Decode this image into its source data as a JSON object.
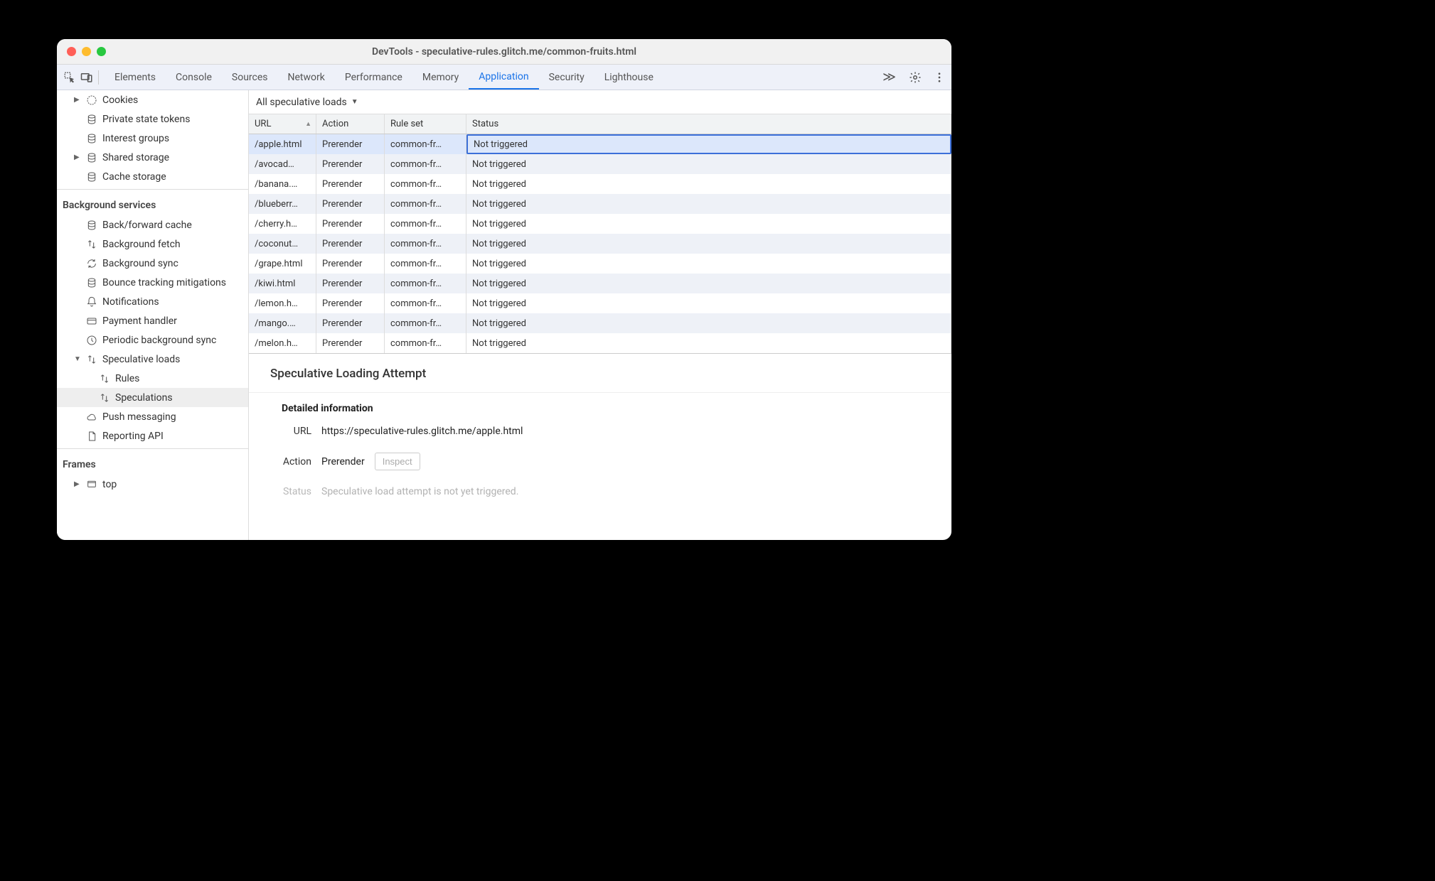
{
  "window": {
    "title": "DevTools - speculative-rules.glitch.me/common-fruits.html"
  },
  "tabs": [
    {
      "label": "Elements",
      "active": false
    },
    {
      "label": "Console",
      "active": false
    },
    {
      "label": "Sources",
      "active": false
    },
    {
      "label": "Network",
      "active": false
    },
    {
      "label": "Performance",
      "active": false
    },
    {
      "label": "Memory",
      "active": false
    },
    {
      "label": "Application",
      "active": true
    },
    {
      "label": "Security",
      "active": false
    },
    {
      "label": "Lighthouse",
      "active": false
    }
  ],
  "overflow_glyph": "≫",
  "sidebar": {
    "storage": [
      {
        "label": "Cookies",
        "icon": "cookies",
        "arrow": true,
        "indent": 1
      },
      {
        "label": "Private state tokens",
        "icon": "db",
        "indent": 1
      },
      {
        "label": "Interest groups",
        "icon": "db",
        "indent": 1
      },
      {
        "label": "Shared storage",
        "icon": "db",
        "arrow": true,
        "indent": 1
      },
      {
        "label": "Cache storage",
        "icon": "db",
        "indent": 1
      }
    ],
    "bg_title": "Background services",
    "bg": [
      {
        "label": "Back/forward cache",
        "icon": "db",
        "indent": 1
      },
      {
        "label": "Background fetch",
        "icon": "updown",
        "indent": 1
      },
      {
        "label": "Background sync",
        "icon": "sync",
        "indent": 1
      },
      {
        "label": "Bounce tracking mitigations",
        "icon": "db",
        "indent": 1
      },
      {
        "label": "Notifications",
        "icon": "bell",
        "indent": 1
      },
      {
        "label": "Payment handler",
        "icon": "card",
        "indent": 1
      },
      {
        "label": "Periodic background sync",
        "icon": "clock",
        "indent": 1
      },
      {
        "label": "Speculative loads",
        "icon": "updown",
        "arrow": true,
        "expanded": true,
        "indent": 1
      },
      {
        "label": "Rules",
        "icon": "updown",
        "indent": 2
      },
      {
        "label": "Speculations",
        "icon": "updown",
        "indent": 2,
        "selected": true
      },
      {
        "label": "Push messaging",
        "icon": "cloud",
        "indent": 1
      },
      {
        "label": "Reporting API",
        "icon": "doc",
        "indent": 1
      }
    ],
    "frames_title": "Frames",
    "frames": [
      {
        "label": "top",
        "icon": "frame",
        "arrow": true,
        "indent": 1
      }
    ]
  },
  "filter_label": "All speculative loads",
  "table": {
    "columns": {
      "url": "URL",
      "action": "Action",
      "ruleset": "Rule set",
      "status": "Status"
    },
    "rows": [
      {
        "url": "/apple.html",
        "action": "Prerender",
        "ruleset": "common-fr…",
        "status": "Not triggered",
        "selected": true
      },
      {
        "url": "/avocad…",
        "action": "Prerender",
        "ruleset": "common-fr…",
        "status": "Not triggered"
      },
      {
        "url": "/banana.…",
        "action": "Prerender",
        "ruleset": "common-fr…",
        "status": "Not triggered"
      },
      {
        "url": "/blueberr…",
        "action": "Prerender",
        "ruleset": "common-fr…",
        "status": "Not triggered"
      },
      {
        "url": "/cherry.h…",
        "action": "Prerender",
        "ruleset": "common-fr…",
        "status": "Not triggered"
      },
      {
        "url": "/coconut…",
        "action": "Prerender",
        "ruleset": "common-fr…",
        "status": "Not triggered"
      },
      {
        "url": "/grape.html",
        "action": "Prerender",
        "ruleset": "common-fr…",
        "status": "Not triggered"
      },
      {
        "url": "/kiwi.html",
        "action": "Prerender",
        "ruleset": "common-fr…",
        "status": "Not triggered"
      },
      {
        "url": "/lemon.h…",
        "action": "Prerender",
        "ruleset": "common-fr…",
        "status": "Not triggered"
      },
      {
        "url": "/mango.…",
        "action": "Prerender",
        "ruleset": "common-fr…",
        "status": "Not triggered"
      },
      {
        "url": "/melon.h…",
        "action": "Prerender",
        "ruleset": "common-fr…",
        "status": "Not triggered"
      }
    ]
  },
  "details": {
    "title": "Speculative Loading Attempt",
    "section_title": "Detailed information",
    "url_label": "URL",
    "url_value": "https://speculative-rules.glitch.me/apple.html",
    "action_label": "Action",
    "action_value": "Prerender",
    "inspect_label": "Inspect",
    "status_label": "Status",
    "status_value": "Speculative load attempt is not yet triggered."
  }
}
